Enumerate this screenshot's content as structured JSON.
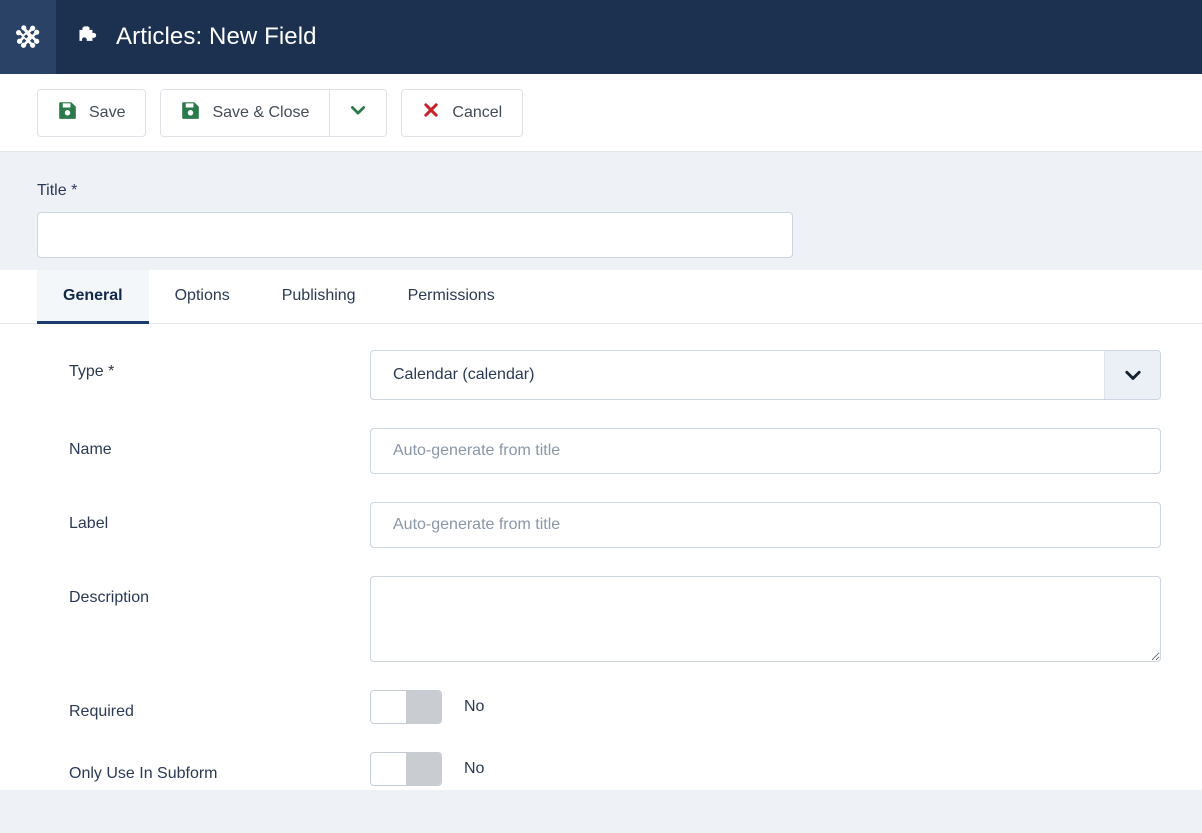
{
  "header": {
    "logo_icon": "joomla-logo-icon",
    "page_icon": "puzzle-piece-icon",
    "title": "Articles: New Field"
  },
  "toolbar": {
    "save_label": "Save",
    "save_close_label": "Save & Close",
    "save_close_dropdown_icon": "chevron-down-icon",
    "cancel_label": "Cancel",
    "save_icon": "floppy-disk-icon",
    "cancel_icon": "close-x-icon",
    "accent_green": "#2c7a4b",
    "accent_red": "#c52127"
  },
  "title_field": {
    "label": "Title *",
    "value": "",
    "placeholder": ""
  },
  "tabs": [
    {
      "label": "General",
      "active": true
    },
    {
      "label": "Options",
      "active": false
    },
    {
      "label": "Publishing",
      "active": false
    },
    {
      "label": "Permissions",
      "active": false
    }
  ],
  "form": {
    "type": {
      "label": "Type *",
      "value": "Calendar (calendar)",
      "arrow_icon": "chevron-down-icon"
    },
    "name": {
      "label": "Name",
      "value": "",
      "placeholder": "Auto-generate from title"
    },
    "field_label": {
      "label": "Label",
      "value": "",
      "placeholder": "Auto-generate from title"
    },
    "description": {
      "label": "Description",
      "value": "",
      "placeholder": ""
    },
    "required": {
      "label": "Required",
      "state": "No"
    },
    "only_use_in_subform": {
      "label": "Only Use In Subform",
      "state": "No"
    }
  }
}
